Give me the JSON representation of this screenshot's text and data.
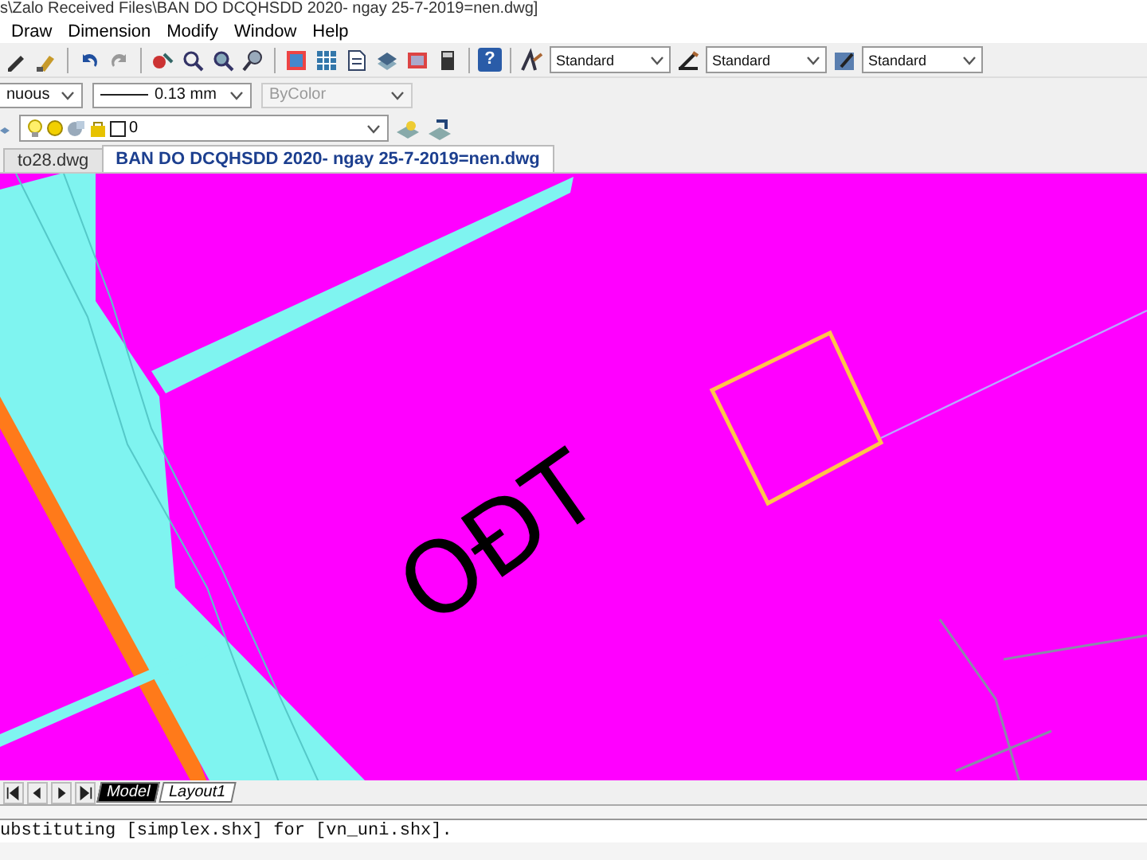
{
  "window": {
    "title": "s\\Zalo Received Files\\BAN DO DCQHSDD 2020- ngay 25-7-2019=nen.dwg]"
  },
  "help_button": "?",
  "menu": [
    "Draw",
    "Dimension",
    "Modify",
    "Window",
    "Help"
  ],
  "style_toolbar": [
    {
      "kind": "text",
      "value": "Standard"
    },
    {
      "kind": "dimension",
      "value": "Standard"
    },
    {
      "kind": "table",
      "value": "Standard"
    }
  ],
  "properties": {
    "linetype": "nuous",
    "lineweight": "0.13 mm",
    "plot_style": {
      "value": "ByColor",
      "disabled": true
    }
  },
  "layer": {
    "value": "0"
  },
  "tabs": [
    {
      "label": "to28.dwg",
      "selected": false
    },
    {
      "label": "BAN DO DCQHSDD 2020- ngay 25-7-2019=nen.dwg",
      "selected": true
    }
  ],
  "drawing": {
    "label": "OĐT"
  },
  "layout_tabs": [
    {
      "label": "Model",
      "selected": true
    },
    {
      "label": "Layout1",
      "selected": false
    }
  ],
  "command_line": [
    "ubstituting [simplex.shx] for [vn_uni.shx]."
  ]
}
